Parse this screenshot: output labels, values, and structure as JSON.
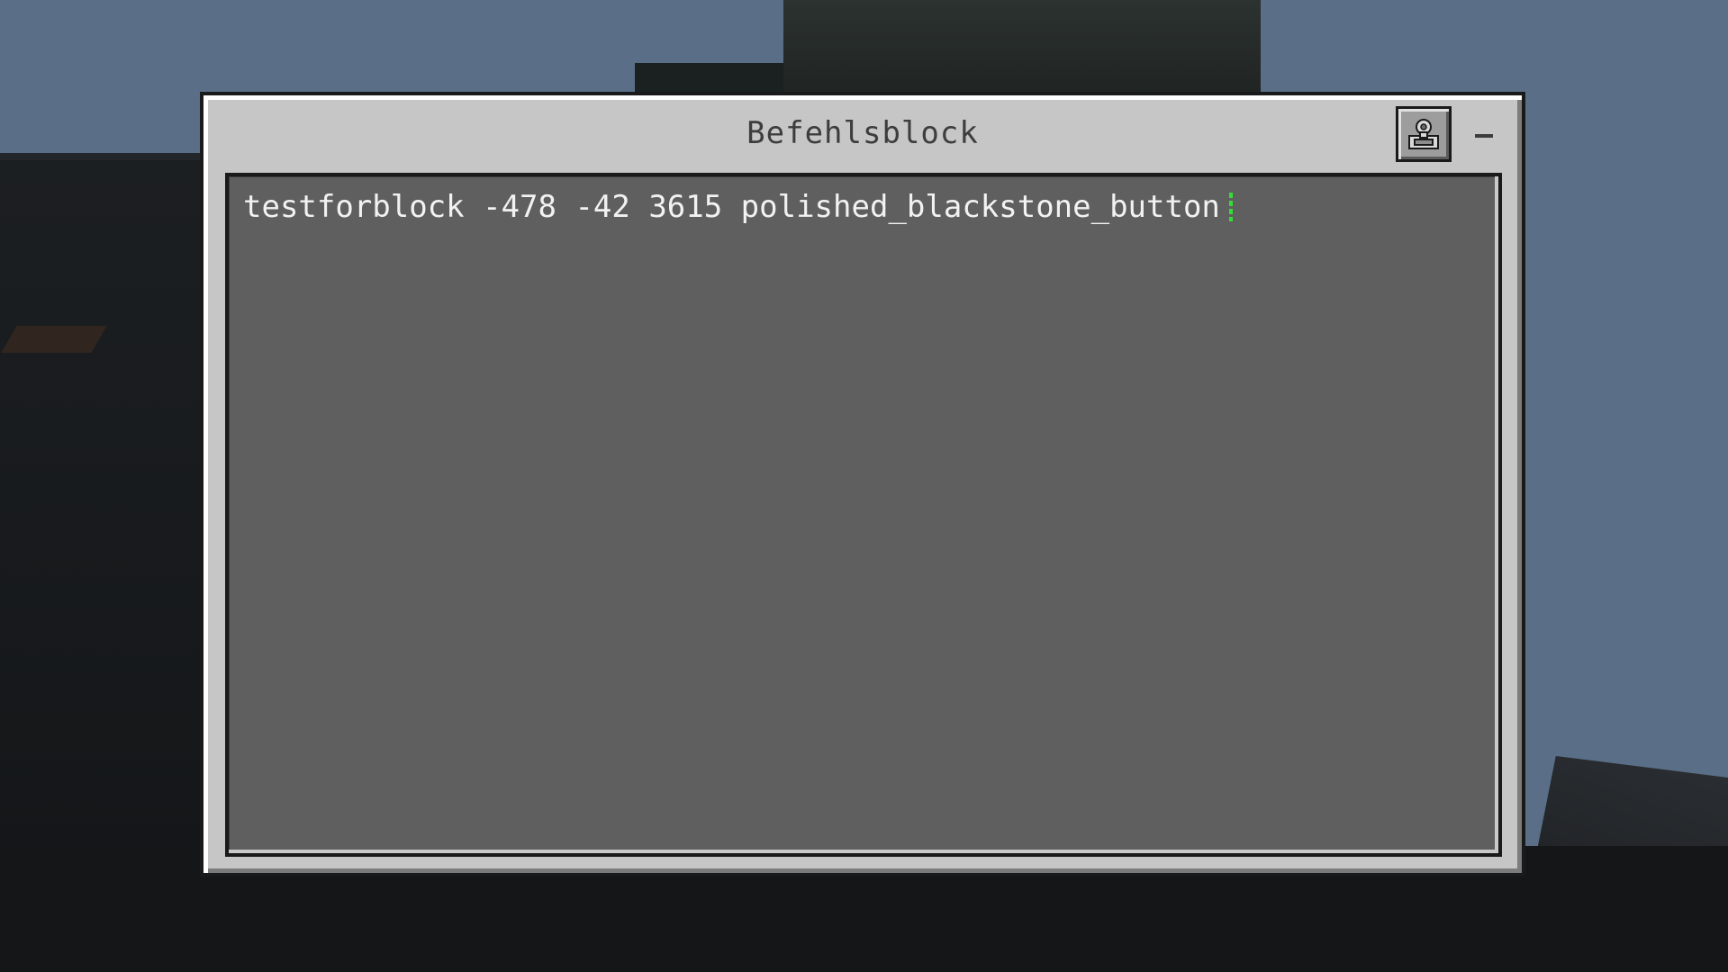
{
  "window": {
    "title": "Befehlsblock",
    "icon": "command-block-icon",
    "minimize_icon": "minimize-icon"
  },
  "command": {
    "value": "testforblock -478 -42 3615 polished_blackstone_button",
    "caret_color": "#33dd33"
  },
  "colors": {
    "panel": "#c6c6c6",
    "input_background": "#5f5f5f",
    "text": "#f2f2f2",
    "title_text": "#3d3d3d"
  }
}
